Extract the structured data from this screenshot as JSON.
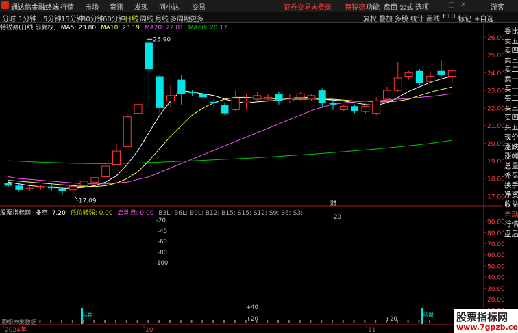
{
  "app": {
    "title": "通达信金融终端"
  },
  "menu": {
    "items": [
      "行情",
      "市场",
      "资讯",
      "发现",
      "问小达",
      "交易"
    ],
    "login_notice": "证券交易未登录",
    "stock_link": "特锐德",
    "right_items": [
      "功能",
      "盘面",
      "公式",
      "选项"
    ],
    "guest": "游客"
  },
  "toolbar": {
    "periods": [
      "分时",
      "1分钟",
      "5分钟",
      "15分钟",
      "30分钟",
      "60分钟",
      "日线",
      "周线",
      "月线",
      "多周期",
      "更多"
    ],
    "active_period": "日线",
    "right_buttons": [
      "复权",
      "叠加",
      "多股",
      "统计",
      "画线",
      "F10",
      "标记",
      "+自选"
    ]
  },
  "chart_header": {
    "stock": "特锐德(日线 前复权)",
    "ma5": "MA5: 23.80",
    "ma10": "MA10: 23.19",
    "ma20": "MA20: 22.81",
    "ma60": "MA60: 20.17"
  },
  "indicator_header": {
    "name": "股票指标网",
    "duokong": "多空: 7.20",
    "diwei": "低位转强: 0.00",
    "qidong": "启动点: 0.00",
    "rest": "B3L: B6L: B9L: B12: B15: S15: S12: S9: S6: S3:"
  },
  "labels": {
    "fin_marker": "财",
    "bottom_left": "周期未来数据"
  },
  "x_axis": {
    "start_year": "2024年",
    "month1": "10",
    "month2": "11"
  },
  "right_panel": [
    "委比",
    "卖五",
    "卖四",
    "卖三",
    "卖二",
    "卖一",
    "买一",
    "买二",
    "买三",
    "买四",
    "买五",
    "现价",
    "涨跌",
    "涨幅",
    "总量",
    "外盘",
    "换手",
    "净资",
    "收益",
    "自动",
    "行情",
    "盘后"
  ],
  "watermark": {
    "line1": "股票指标网",
    "line2": "www.7gpzb.com"
  },
  "colors": {
    "up": "#ff3232",
    "down": "#00e6e6",
    "ma5": "#ffffff",
    "ma10": "#ffff50",
    "ma20": "#ff50ff",
    "ma60": "#00c800"
  },
  "chart_data": {
    "type": "candlestick",
    "price_axis": {
      "ticks": [
        "26.00",
        "25.00",
        "24.00",
        "23.00",
        "22.00",
        "21.00",
        "20.00",
        "19.00",
        "18.00",
        "17.00"
      ],
      "range": [
        16.8,
        26.3
      ]
    },
    "annotations": {
      "high": "25.90",
      "low": "17.09"
    },
    "candles": [
      {
        "o": 17.75,
        "c": 17.6,
        "h": 17.9,
        "l": 17.5
      },
      {
        "o": 17.6,
        "c": 17.35,
        "h": 17.7,
        "l": 17.25
      },
      {
        "o": 17.4,
        "c": 17.45,
        "h": 17.55,
        "l": 17.3
      },
      {
        "o": 17.5,
        "c": 17.55,
        "h": 17.65,
        "l": 17.35
      },
      {
        "o": 17.55,
        "c": 17.45,
        "h": 17.75,
        "l": 17.3
      },
      {
        "o": 17.4,
        "c": 17.3,
        "h": 17.5,
        "l": 17.1
      },
      {
        "o": 17.35,
        "c": 17.55,
        "h": 17.7,
        "l": 17.09
      },
      {
        "o": 17.6,
        "c": 17.85,
        "h": 18.1,
        "l": 17.5
      },
      {
        "o": 17.8,
        "c": 18.05,
        "h": 18.5,
        "l": 17.75
      },
      {
        "o": 18.1,
        "c": 18.7,
        "h": 18.9,
        "l": 18.0
      },
      {
        "o": 18.8,
        "c": 19.55,
        "h": 20.0,
        "l": 18.75
      },
      {
        "o": 19.8,
        "c": 21.5,
        "h": 21.7,
        "l": 19.8
      },
      {
        "o": 21.7,
        "c": 22.2,
        "h": 22.5,
        "l": 21.6
      },
      {
        "o": 25.7,
        "c": 24.2,
        "h": 25.9,
        "l": 22.0
      },
      {
        "o": 23.8,
        "c": 22.0,
        "h": 23.9,
        "l": 21.7
      },
      {
        "o": 22.4,
        "c": 22.7,
        "h": 23.3,
        "l": 22.1
      },
      {
        "o": 23.6,
        "c": 22.8,
        "h": 23.9,
        "l": 22.2
      },
      {
        "o": 22.9,
        "c": 22.85,
        "h": 23.0,
        "l": 22.7
      },
      {
        "o": 22.8,
        "c": 22.6,
        "h": 23.2,
        "l": 22.4
      },
      {
        "o": 22.35,
        "c": 22.3,
        "h": 22.5,
        "l": 22.0
      },
      {
        "o": 22.15,
        "c": 21.7,
        "h": 22.3,
        "l": 21.6
      },
      {
        "o": 21.9,
        "c": 22.55,
        "h": 23.0,
        "l": 21.8
      },
      {
        "o": 22.3,
        "c": 22.4,
        "h": 22.8,
        "l": 21.9
      },
      {
        "o": 22.5,
        "c": 22.7,
        "h": 22.9,
        "l": 22.4
      },
      {
        "o": 22.5,
        "c": 22.6,
        "h": 22.8,
        "l": 22.4
      },
      {
        "o": 22.8,
        "c": 22.4,
        "h": 22.9,
        "l": 22.2
      },
      {
        "o": 22.4,
        "c": 22.5,
        "h": 22.8,
        "l": 22.3
      },
      {
        "o": 22.6,
        "c": 22.8,
        "h": 22.9,
        "l": 22.4
      },
      {
        "o": 22.5,
        "c": 22.7,
        "h": 22.8,
        "l": 22.4
      },
      {
        "o": 23.0,
        "c": 22.3,
        "h": 23.1,
        "l": 22.0
      },
      {
        "o": 22.3,
        "c": 22.2,
        "h": 22.5,
        "l": 21.9
      },
      {
        "o": 21.9,
        "c": 22.1,
        "h": 22.2,
        "l": 21.8
      },
      {
        "o": 22.1,
        "c": 21.8,
        "h": 22.2,
        "l": 21.7
      },
      {
        "o": 21.8,
        "c": 22.1,
        "h": 22.3,
        "l": 21.7
      },
      {
        "o": 21.7,
        "c": 22.4,
        "h": 22.6,
        "l": 21.6
      },
      {
        "o": 22.5,
        "c": 23.0,
        "h": 23.2,
        "l": 22.4
      },
      {
        "o": 23.0,
        "c": 23.7,
        "h": 24.6,
        "l": 22.9
      },
      {
        "o": 23.8,
        "c": 24.0,
        "h": 24.1,
        "l": 23.6
      },
      {
        "o": 24.1,
        "c": 23.4,
        "h": 24.2,
        "l": 23.3
      },
      {
        "o": 23.5,
        "c": 23.8,
        "h": 24.0,
        "l": 23.4
      },
      {
        "o": 24.1,
        "c": 23.9,
        "h": 24.7,
        "l": 23.8
      },
      {
        "o": 23.8,
        "c": 24.1,
        "h": 24.2,
        "l": 23.4
      }
    ],
    "series": [
      {
        "name": "MA5",
        "values": [
          17.8,
          17.7,
          17.6,
          17.55,
          17.5,
          17.45,
          17.45,
          17.5,
          17.6,
          17.8,
          18.15,
          18.8,
          19.6,
          20.6,
          21.6,
          22.4,
          23.0,
          22.9,
          22.8,
          22.7,
          22.5,
          22.35,
          22.3,
          22.35,
          22.4,
          22.45,
          22.55,
          22.6,
          22.6,
          22.5,
          22.45,
          22.4,
          22.3,
          22.2,
          22.15,
          22.3,
          22.6,
          22.95,
          23.2,
          23.45,
          23.65,
          23.8
        ]
      },
      {
        "name": "MA10",
        "values": [
          17.9,
          17.85,
          17.8,
          17.75,
          17.7,
          17.65,
          17.6,
          17.55,
          17.55,
          17.6,
          17.75,
          18.0,
          18.4,
          19.0,
          19.7,
          20.4,
          21.0,
          21.6,
          22.0,
          22.3,
          22.5,
          22.6,
          22.6,
          22.55,
          22.55,
          22.5,
          22.5,
          22.5,
          22.5,
          22.5,
          22.5,
          22.45,
          22.4,
          22.4,
          22.35,
          22.35,
          22.4,
          22.5,
          22.7,
          22.9,
          23.05,
          23.19
        ]
      },
      {
        "name": "MA20",
        "values": [
          18.1,
          18.0,
          17.95,
          17.9,
          17.85,
          17.8,
          17.75,
          17.7,
          17.7,
          17.7,
          17.75,
          17.8,
          17.95,
          18.1,
          18.35,
          18.6,
          18.85,
          19.1,
          19.35,
          19.6,
          19.85,
          20.1,
          20.35,
          20.6,
          20.85,
          21.1,
          21.35,
          21.6,
          21.85,
          22.05,
          22.2,
          22.3,
          22.35,
          22.4,
          22.4,
          22.45,
          22.5,
          22.55,
          22.6,
          22.65,
          22.72,
          22.81
        ]
      },
      {
        "name": "MA60",
        "values": [
          19.0,
          18.98,
          18.95,
          18.92,
          18.9,
          18.88,
          18.86,
          18.85,
          18.84,
          18.84,
          18.85,
          18.86,
          18.88,
          18.9,
          18.92,
          18.95,
          18.98,
          19.0,
          19.03,
          19.06,
          19.09,
          19.12,
          19.15,
          19.18,
          19.22,
          19.26,
          19.3,
          19.34,
          19.38,
          19.42,
          19.47,
          19.52,
          19.57,
          19.62,
          19.67,
          19.73,
          19.79,
          19.85,
          19.92,
          19.99,
          20.08,
          20.17
        ]
      }
    ],
    "indicator_axis": {
      "ticks": [
        "90.00",
        "80.00",
        "70.00",
        "60.00",
        "50.00",
        "40.00",
        "30.00",
        "20.00",
        "10.00"
      ],
      "range": [
        0,
        95
      ]
    },
    "indicator_labels": [
      "-20",
      "-40",
      "-60",
      "-80",
      "-100",
      "-20",
      "+40",
      "+20",
      "+20"
    ],
    "signal_label": "马盘"
  }
}
